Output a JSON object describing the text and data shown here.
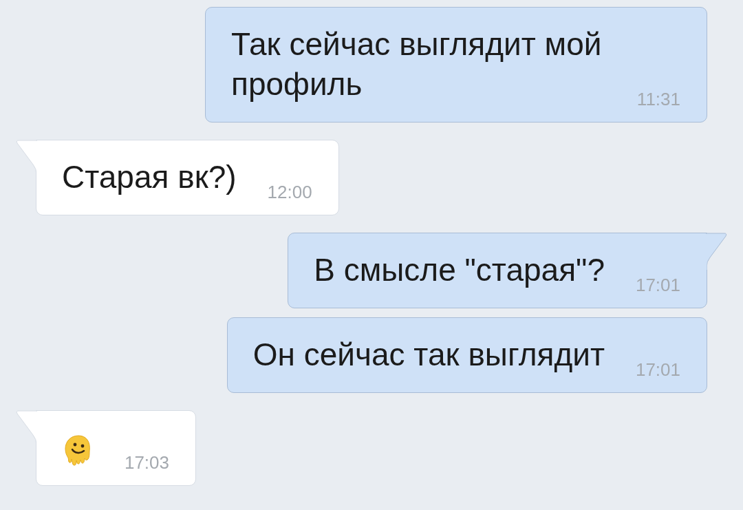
{
  "messages": [
    {
      "outgoing": true,
      "kind": "text",
      "text": "Так сейчас выглядит мой профиль",
      "time": "11:31",
      "tail": false
    },
    {
      "outgoing": false,
      "kind": "text",
      "text": "Старая вк?)",
      "time": "12:00",
      "tail": true
    },
    {
      "outgoing": true,
      "kind": "text",
      "text": "В смысле \"старая\"?",
      "time": "17:01",
      "tail": true
    },
    {
      "outgoing": true,
      "kind": "text",
      "text": "Он сейчас так выглядит",
      "time": "17:01",
      "tail": false
    },
    {
      "outgoing": false,
      "kind": "emoji",
      "time": "17:03",
      "tail": true
    }
  ]
}
